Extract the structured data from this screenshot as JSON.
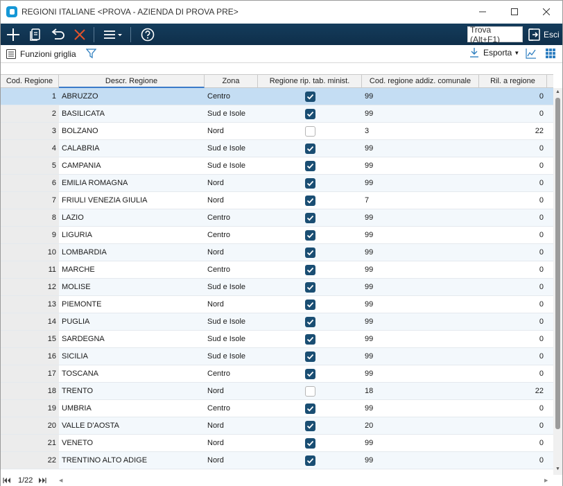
{
  "window": {
    "title": "REGIONI ITALIANE <PROVA - AZIENDA DI PROVA PRE>"
  },
  "toolbar": {
    "icons": [
      "add-icon",
      "copy-icon",
      "undo-icon",
      "delete-icon",
      "menu-icon",
      "help-icon"
    ],
    "search_label": "Trova (Alt+F1)",
    "exit_label": "Esci"
  },
  "subbar": {
    "grid_functions_label": "Funzioni griglia",
    "export_label": "Esporta"
  },
  "grid": {
    "columns": [
      "Cod. Regione",
      "Descr. Regione",
      "Zona",
      "Regione rip. tab. minist.",
      "Cod. regione addiz. comunale",
      "Ril. a regione"
    ],
    "rows": [
      {
        "code": "1",
        "desc": "ABRUZZO",
        "zone": "Centro",
        "checked": true,
        "addiz": "99",
        "ril": "0"
      },
      {
        "code": "2",
        "desc": "BASILICATA",
        "zone": "Sud e Isole",
        "checked": true,
        "addiz": "99",
        "ril": "0"
      },
      {
        "code": "3",
        "desc": "BOLZANO",
        "zone": "Nord",
        "checked": false,
        "addiz": "3",
        "ril": "22"
      },
      {
        "code": "4",
        "desc": "CALABRIA",
        "zone": "Sud e Isole",
        "checked": true,
        "addiz": "99",
        "ril": "0"
      },
      {
        "code": "5",
        "desc": "CAMPANIA",
        "zone": "Sud e Isole",
        "checked": true,
        "addiz": "99",
        "ril": "0"
      },
      {
        "code": "6",
        "desc": "EMILIA ROMAGNA",
        "zone": "Nord",
        "checked": true,
        "addiz": "99",
        "ril": "0"
      },
      {
        "code": "7",
        "desc": "FRIULI VENEZIA GIULIA",
        "zone": "Nord",
        "checked": true,
        "addiz": "7",
        "ril": "0"
      },
      {
        "code": "8",
        "desc": "LAZIO",
        "zone": "Centro",
        "checked": true,
        "addiz": "99",
        "ril": "0"
      },
      {
        "code": "9",
        "desc": "LIGURIA",
        "zone": "Centro",
        "checked": true,
        "addiz": "99",
        "ril": "0"
      },
      {
        "code": "10",
        "desc": "LOMBARDIA",
        "zone": "Nord",
        "checked": true,
        "addiz": "99",
        "ril": "0"
      },
      {
        "code": "11",
        "desc": "MARCHE",
        "zone": "Centro",
        "checked": true,
        "addiz": "99",
        "ril": "0"
      },
      {
        "code": "12",
        "desc": "MOLISE",
        "zone": "Sud e Isole",
        "checked": true,
        "addiz": "99",
        "ril": "0"
      },
      {
        "code": "13",
        "desc": "PIEMONTE",
        "zone": "Nord",
        "checked": true,
        "addiz": "99",
        "ril": "0"
      },
      {
        "code": "14",
        "desc": "PUGLIA",
        "zone": "Sud e Isole",
        "checked": true,
        "addiz": "99",
        "ril": "0"
      },
      {
        "code": "15",
        "desc": "SARDEGNA",
        "zone": "Sud e Isole",
        "checked": true,
        "addiz": "99",
        "ril": "0"
      },
      {
        "code": "16",
        "desc": "SICILIA",
        "zone": "Sud e Isole",
        "checked": true,
        "addiz": "99",
        "ril": "0"
      },
      {
        "code": "17",
        "desc": "TOSCANA",
        "zone": "Centro",
        "checked": true,
        "addiz": "99",
        "ril": "0"
      },
      {
        "code": "18",
        "desc": "TRENTO",
        "zone": "Nord",
        "checked": false,
        "addiz": "18",
        "ril": "22"
      },
      {
        "code": "19",
        "desc": "UMBRIA",
        "zone": "Centro",
        "checked": true,
        "addiz": "99",
        "ril": "0"
      },
      {
        "code": "20",
        "desc": "VALLE D'AOSTA",
        "zone": "Nord",
        "checked": true,
        "addiz": "20",
        "ril": "0"
      },
      {
        "code": "21",
        "desc": "VENETO",
        "zone": "Nord",
        "checked": true,
        "addiz": "99",
        "ril": "0"
      },
      {
        "code": "22",
        "desc": "TRENTINO ALTO ADIGE",
        "zone": "Nord",
        "checked": true,
        "addiz": "99",
        "ril": "0"
      }
    ],
    "selected_row": 0
  },
  "pager": {
    "indicator": "1/22"
  },
  "colors": {
    "toolbar_bg": "#143c5c",
    "checkbox_on": "#1a4e73",
    "selected_row": "#c4ddf3",
    "alt_row": "#f3f8fc",
    "header_active": "#3a7ac8"
  }
}
